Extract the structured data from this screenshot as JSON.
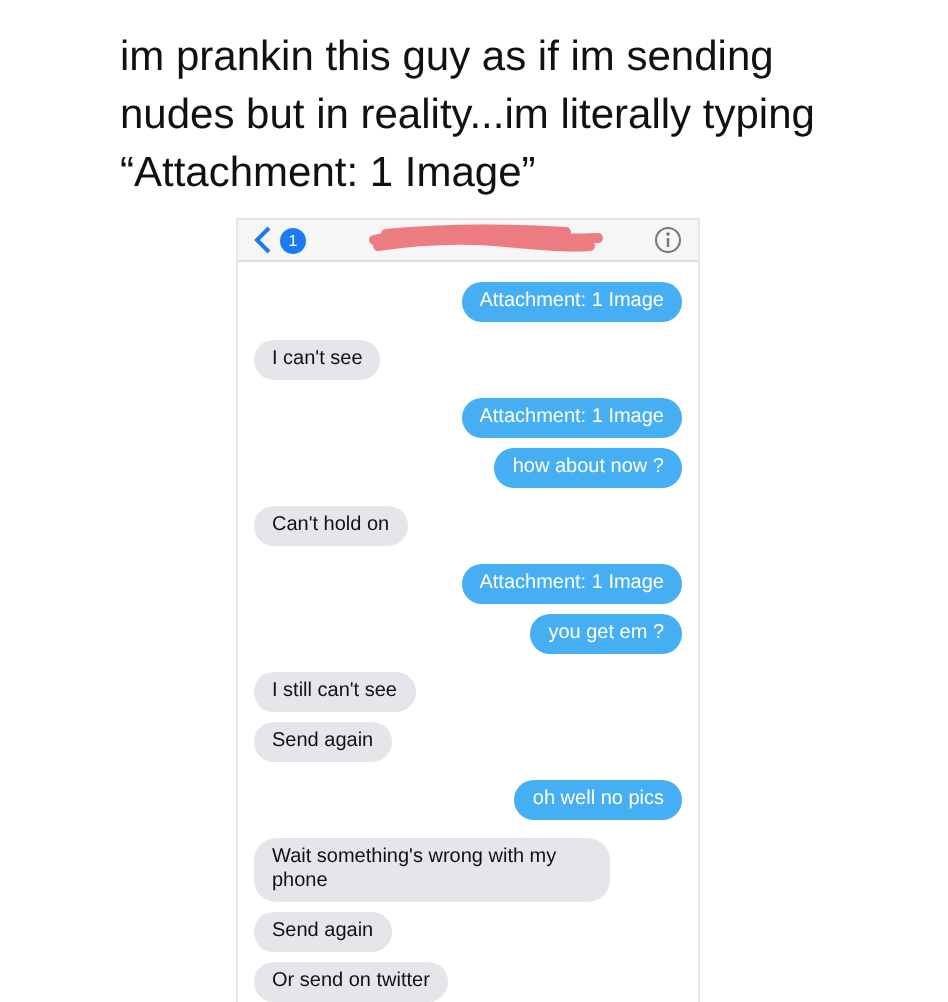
{
  "caption": "im prankin this guy as if im sending nudes but in reality...im literally typing “Attachment: 1 Image”",
  "header": {
    "back_badge": "1"
  },
  "messages": [
    {
      "kind": "sent",
      "text": "Attachment: 1 Image"
    },
    {
      "kind": "received",
      "text": "I can't see"
    },
    {
      "kind": "sent",
      "text": "Attachment: 1 Image"
    },
    {
      "kind": "sent",
      "text": "how about now ?"
    },
    {
      "kind": "received",
      "text": "Can't hold on"
    },
    {
      "kind": "sent",
      "text": "Attachment: 1 Image"
    },
    {
      "kind": "sent",
      "text": "you get em ?"
    },
    {
      "kind": "received",
      "text": "I still can't see"
    },
    {
      "kind": "received",
      "text": "Send again"
    },
    {
      "kind": "sent",
      "text": "oh well no pics"
    },
    {
      "kind": "received",
      "text": "Wait something's wrong with my phone"
    },
    {
      "kind": "received",
      "text": "Send again"
    },
    {
      "kind": "received",
      "text": "Or send on twitter"
    }
  ]
}
